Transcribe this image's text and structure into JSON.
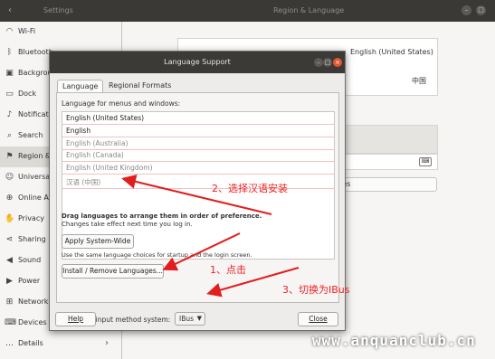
{
  "window": {
    "app_title": "Settings",
    "panel_title": "Region & Language"
  },
  "sidebar": {
    "items": [
      {
        "label": "Wi-Fi",
        "icon": "wifi-icon",
        "glyph": "◠"
      },
      {
        "label": "Bluetooth",
        "icon": "bluetooth-icon",
        "glyph": "ᛒ"
      },
      {
        "label": "Background",
        "icon": "background-icon",
        "glyph": "▣"
      },
      {
        "label": "Dock",
        "icon": "dock-icon",
        "glyph": "▭"
      },
      {
        "label": "Notifications",
        "icon": "notifications-icon",
        "glyph": "♪"
      },
      {
        "label": "Search",
        "icon": "search-icon",
        "glyph": "⌕"
      },
      {
        "label": "Region & Language",
        "icon": "region-icon",
        "glyph": "⚑"
      },
      {
        "label": "Universal Access",
        "icon": "universal-access-icon",
        "glyph": "☺"
      },
      {
        "label": "Online Accounts",
        "icon": "online-accounts-icon",
        "glyph": "⊕"
      },
      {
        "label": "Privacy",
        "icon": "privacy-icon",
        "glyph": "✋"
      },
      {
        "label": "Sharing",
        "icon": "sharing-icon",
        "glyph": "⋖"
      },
      {
        "label": "Sound",
        "icon": "sound-icon",
        "glyph": "◀"
      },
      {
        "label": "Power",
        "icon": "power-icon",
        "glyph": "▶"
      },
      {
        "label": "Network",
        "icon": "network-icon",
        "glyph": "⊞"
      },
      {
        "label": "Devices",
        "icon": "devices-icon",
        "glyph": "⌨"
      },
      {
        "label": "Details",
        "icon": "details-icon",
        "glyph": "…"
      }
    ]
  },
  "region_panel": {
    "language_value": "English (United States)",
    "formats_value": "中国",
    "manage_button": "ges"
  },
  "dialog": {
    "title": "Language Support",
    "tabs": [
      "Language",
      "Regional Formats"
    ],
    "list_heading": "Language for menus and windows:",
    "languages": [
      "English (United States)",
      "English",
      "English (Australia)",
      "English (Canada)",
      "English (United Kingdom)",
      "汉语 (中国)"
    ],
    "drag_hint": "Drag languages to arrange them in order of preference.",
    "drag_subhint": "Changes take effect next time you log in.",
    "apply_button": "Apply System-Wide",
    "same_choices_hint": "Use the same language choices for startup and the login screen.",
    "install_button": "Install / Remove Languages...",
    "keyboard_label": "Keyboard input method system:",
    "keyboard_value": "IBus",
    "help_button": "Help",
    "close_button": "Close"
  },
  "annotations": {
    "step1": "1、点击",
    "step2": "2、选择汉语安装",
    "step3": "3、切换为IBus",
    "annotation_color": "#e21d1d"
  },
  "watermark": "www.anquanclub.cn"
}
